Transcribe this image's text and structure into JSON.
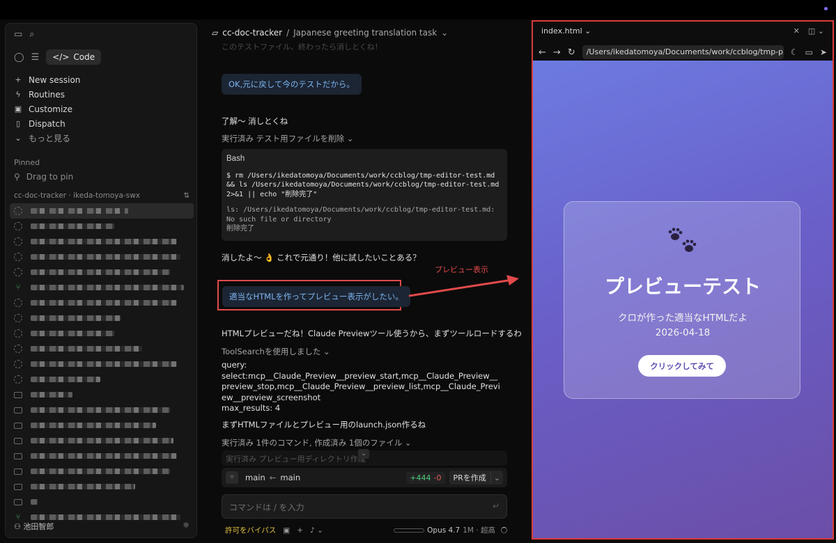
{
  "sidebar": {
    "code_tab": "Code",
    "nav": [
      {
        "icon": "plus-icon",
        "label": "New session"
      },
      {
        "icon": "bolt-icon",
        "label": "Routines"
      },
      {
        "icon": "briefcase-icon",
        "label": "Customize"
      },
      {
        "icon": "phone-icon",
        "label": "Dispatch"
      },
      {
        "icon": "chevron-down-icon",
        "label": "もっと見る"
      }
    ],
    "pinned_label": "Pinned",
    "drag_to_pin": "Drag to pin",
    "project": "cc-doc-tracker · ikeda-tomoya-swx",
    "user": "池田智郎"
  },
  "chat": {
    "project": "cc-doc-tracker",
    "separator": "/",
    "task": "Japanese greeting translation task",
    "ghost_line": "このテストファイル、終わったら消しとくね！",
    "user_msg_1": "OK,元に戻して今のテストだから。",
    "reply_1": "了解〜 消しとくね",
    "exec_label": "実行済み テスト用ファイルを削除",
    "code_header": "Bash",
    "code_cmd": "$ rm /Users/ikedatomoya/Documents/work/ccblog/tmp-editor-test.md && ls /Users/ikedatomoya/Documents/work/ccblog/tmp-editor-test.md 2>&1 || echo \"削除完了\"",
    "code_out": "ls: /Users/ikedatomoya/Documents/work/ccblog/tmp-editor-test.md: No such file or directory\n削除完了",
    "reply_2": "消したよ〜 👌 これで元通り！他に試したいことある？",
    "annotation": "プレビュー表示",
    "user_msg_2": "適当なHTMLを作ってプレビュー表示がしたい。",
    "reply_3": "HTMLプレビューだね！Claude Previewツール使うから、まずツールロードするわ",
    "toolsearch_label": "ToolSearchを使用しました",
    "query_label": "query:",
    "query_value": "select:mcp__Claude_Preview__preview_start,mcp__Claude_Preview__preview_stop,mcp__Claude_Preview__preview_list,mcp__Claude_Preview__preview_screenshot",
    "max_results": "max_results: 4",
    "reply_4": "まずHTMLファイルとプレビュー用のlaunch.json作るね",
    "exec_label_2": "実行済み 1件のコマンド, 作成済み 1個のファイル",
    "faded_line": "実行済み プレビュー用ディレクトリ作成",
    "branch_from": "main",
    "branch_to": "main",
    "diff_add": "+444",
    "diff_del": "-0",
    "pr_button": "PRを作成",
    "input_placeholder": "コマンドは / を入力",
    "bypass_label": "許可をバイパス",
    "model_label": "Opus 4.7",
    "model_detail": "1M · 超高"
  },
  "preview": {
    "tab": "index.html",
    "url": "/Users/ikedatomoya/Documents/work/ccblog/tmp-preview",
    "title": "プレビューテスト",
    "subtitle": "クロが作った適当なHTMLだよ",
    "date": "2026-04-18",
    "button": "クリックしてみて"
  },
  "colors": {
    "accent_red": "#e14a4a",
    "user_bubble_text": "#7cb4f0",
    "bypass": "#e0c040",
    "gradient_top": "#6c7be0",
    "gradient_bottom": "#6b4ea7"
  }
}
